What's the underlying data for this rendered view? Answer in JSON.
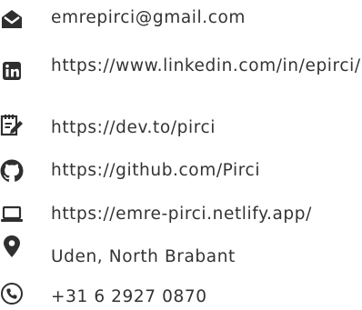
{
  "contacts": [
    {
      "icon": "email-icon",
      "text": "emrepirci@gmail.com"
    },
    {
      "icon": "linkedin-icon",
      "text": "https://www.linkedin.com/in/epirci/"
    },
    {
      "icon": "dev-to-icon",
      "text": "https://dev.to/pirci"
    },
    {
      "icon": "github-icon",
      "text": "https://github.com/Pirci"
    },
    {
      "icon": "laptop-icon",
      "text": "https://emre-pirci.netlify.app/"
    },
    {
      "icon": "location-pin-icon",
      "text": "Uden, North Brabant"
    },
    {
      "icon": "phone-icon",
      "text": "+31 6 2927 0870"
    }
  ]
}
